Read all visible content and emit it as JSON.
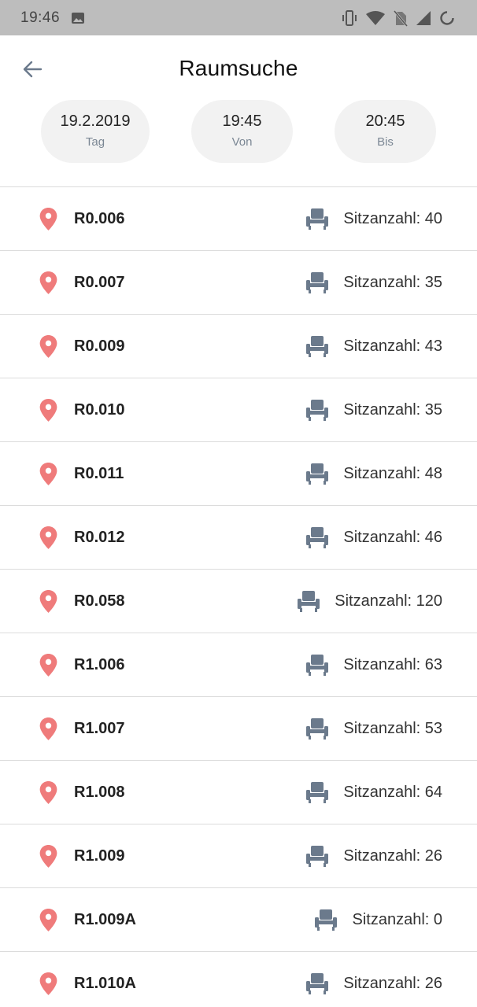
{
  "status_bar": {
    "time": "19:46",
    "icons": [
      "image-icon",
      "vibrate-icon",
      "wifi-icon",
      "no-sim-icon",
      "signal-icon",
      "loading-icon"
    ]
  },
  "header": {
    "title": "Raumsuche",
    "back_icon": "arrow-left-icon"
  },
  "filters": {
    "day": {
      "value": "19.2.2019",
      "label": "Tag"
    },
    "from": {
      "value": "19:45",
      "label": "Von"
    },
    "to": {
      "value": "20:45",
      "label": "Bis"
    }
  },
  "colors": {
    "pin": "#ef7b7b",
    "chair": "#6b7a8c",
    "chip_bg": "#f2f2f2",
    "status_bar": "#bdbdbd"
  },
  "rooms": [
    {
      "name": "R0.006",
      "seats": "Sitzanzahl: 40"
    },
    {
      "name": "R0.007",
      "seats": "Sitzanzahl: 35"
    },
    {
      "name": "R0.009",
      "seats": "Sitzanzahl: 43"
    },
    {
      "name": "R0.010",
      "seats": "Sitzanzahl: 35"
    },
    {
      "name": "R0.011",
      "seats": "Sitzanzahl: 48"
    },
    {
      "name": "R0.012",
      "seats": "Sitzanzahl: 46"
    },
    {
      "name": "R0.058",
      "seats": "Sitzanzahl: 120"
    },
    {
      "name": "R1.006",
      "seats": "Sitzanzahl: 63"
    },
    {
      "name": "R1.007",
      "seats": "Sitzanzahl: 53"
    },
    {
      "name": "R1.008",
      "seats": "Sitzanzahl: 64"
    },
    {
      "name": "R1.009",
      "seats": "Sitzanzahl: 26"
    },
    {
      "name": "R1.009A",
      "seats": "Sitzanzahl: 0"
    },
    {
      "name": "R1.010A",
      "seats": "Sitzanzahl: 26"
    }
  ]
}
